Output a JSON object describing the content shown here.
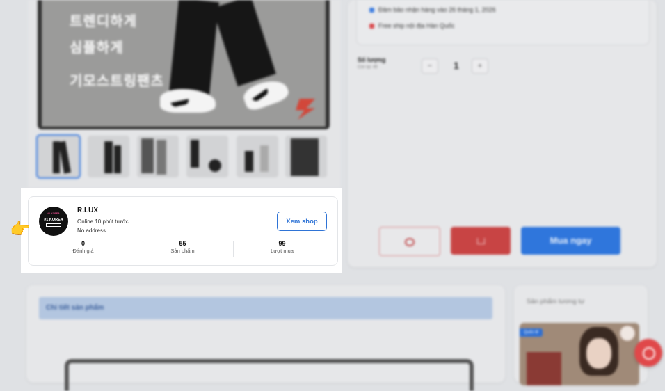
{
  "delivery": {
    "guarantee": "Đảm bảo nhận hàng vào 26 tháng 1, 2026",
    "freeship": "Free ship nội địa Hàn Quốc",
    "guarantee_color": "#3a7be0",
    "freeship_color": "#d9464a"
  },
  "quantity": {
    "label": "Số lượng",
    "remaining": "Còn lại: 49",
    "value": "1",
    "minus": "−",
    "plus": "+"
  },
  "product_image": {
    "line1": "트렌디하게",
    "line2": "심플하게",
    "line3": "기모스트링팬츠"
  },
  "actions": {
    "chat_icon": "chat-icon",
    "cart_icon": "cart-icon",
    "buy_now": "Mua ngay"
  },
  "shop": {
    "avatar_top": "#1 KOREA",
    "avatar_mid": "#1 KOREA",
    "name": "R.LUX",
    "online": "Online 10 phút trước",
    "address": "No address",
    "view_shop": "Xem shop",
    "stats": [
      {
        "value": "0",
        "label": "Đánh giá"
      },
      {
        "value": "55",
        "label": "Sản phẩm"
      },
      {
        "value": "99",
        "label": "Lượt mua"
      }
    ]
  },
  "details": {
    "title": "Chi tiết sản phẩm"
  },
  "similar": {
    "title": "Sản phẩm tương tự",
    "tag": "Quốc tế"
  },
  "pointer": "👉"
}
